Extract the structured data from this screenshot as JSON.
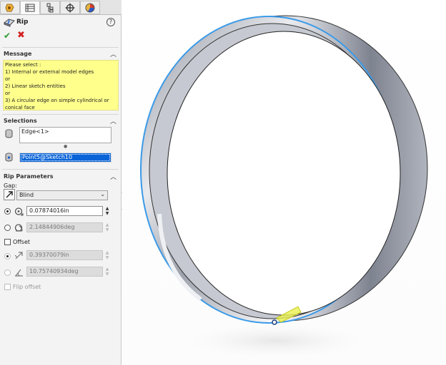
{
  "tabs": [
    {
      "name": "feature-manager",
      "icon": "feature-tree-icon"
    },
    {
      "name": "property-manager",
      "icon": "property-list-icon"
    },
    {
      "name": "configuration-manager",
      "icon": "configuration-icon"
    },
    {
      "name": "dimxpert-manager",
      "icon": "crosshair-icon"
    },
    {
      "name": "display-manager",
      "icon": "appearance-sphere-icon"
    }
  ],
  "header": {
    "title": "Rip",
    "help": "?"
  },
  "actions": {
    "ok": "✔",
    "cancel": "✖"
  },
  "message": {
    "title": "Message",
    "lines": [
      "Please select :",
      "1) Internal or external model edges",
      "or",
      "2) Linear sketch entities",
      "or",
      "3) A circular edge on simple cylindrical or",
      "conical face"
    ]
  },
  "selections": {
    "title": "Selections",
    "edge_list": [
      "Edge<1>"
    ],
    "point_field": "Point5@Sketch10"
  },
  "rip_parameters": {
    "title": "Rip Parameters",
    "gap_label": "Gap:",
    "end_condition": "Blind",
    "gap_distance": "0.07874016in",
    "gap_angle": "2.14844906deg",
    "offset_label": "Offset",
    "offset_distance": "0.39370079in",
    "offset_angle": "10.75740934deg",
    "flip_offset_label": "Flip offset"
  },
  "colors": {
    "message_bg": "#ffff8c",
    "selection_highlight": "#0a64d8",
    "model_edge_highlight": "#3a9ae8",
    "preview_yellow": "#e8f050",
    "ok_green": "#2e9a2e",
    "cancel_red": "#d42020"
  }
}
